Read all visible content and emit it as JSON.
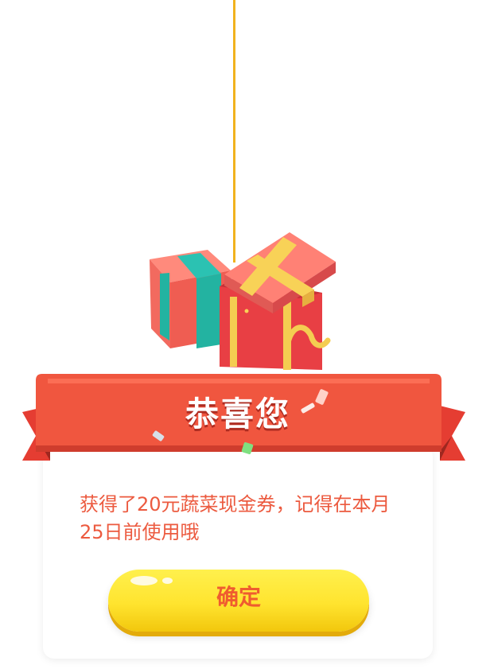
{
  "dialog": {
    "title": "恭喜您",
    "message": "获得了20元蔬菜现金券，记得在本月25日前使用哦",
    "confirm_label": "确定"
  },
  "icons": [
    "hanging-string-icon",
    "gift-box-closed-icon",
    "gift-box-open-icon",
    "confetti-icon"
  ],
  "colors": {
    "ribbon_red": "#f0563f",
    "ribbon_dark": "#cf3c2d",
    "message_text": "#ec5a3f",
    "button_yellow": "#ffe42f",
    "button_text": "#ef5c2f",
    "string": "#f1b21e"
  }
}
